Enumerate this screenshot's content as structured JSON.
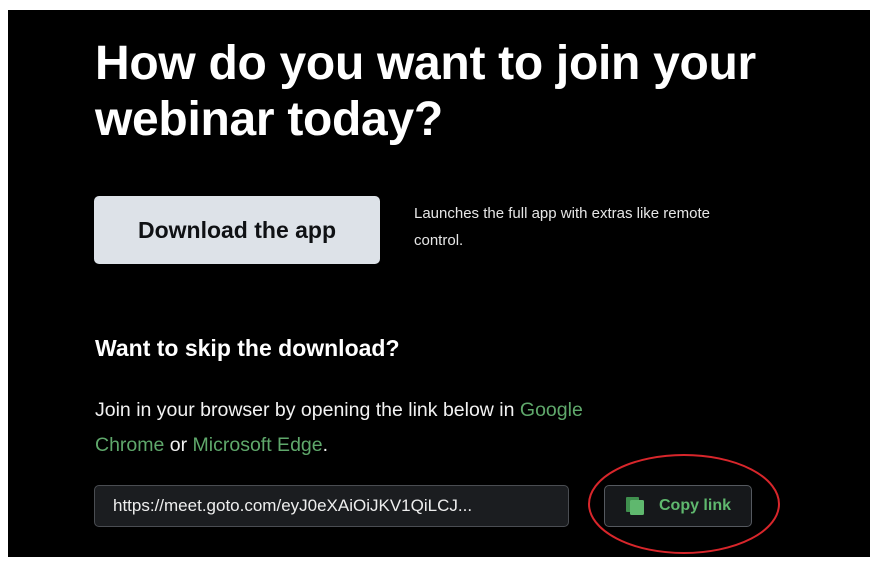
{
  "heading": "How do you want to join your webinar today?",
  "download": {
    "button_label": "Download the app",
    "description": "Launches the full app with extras like remote control."
  },
  "skip": {
    "title": "Want to skip the download?",
    "text_before": "Join in your browser by opening the link below in ",
    "chrome_link": "Google Chrome",
    "text_or": " or ",
    "edge_link": "Microsoft Edge",
    "text_after": "."
  },
  "link_field": {
    "value": "https://meet.goto.com/eyJ0eXAiOiJKV1QiLCJ..."
  },
  "copy_button": {
    "label": "Copy link",
    "icon": "copy-icon"
  },
  "colors": {
    "background": "#000000",
    "link_green": "#5fa86b",
    "button_light": "#dde2e8",
    "annotation_red": "#d8262b"
  }
}
